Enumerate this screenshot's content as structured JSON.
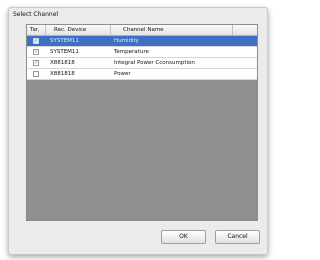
{
  "dialog": {
    "title": "Select Channel"
  },
  "table": {
    "columns": [
      "Tar.",
      "Rec. Device",
      "Channel Name"
    ],
    "rows": [
      {
        "checked": true,
        "checkbox_glyph": "✓",
        "device": "SYSTEM11",
        "name": "Humidity",
        "selected": true
      },
      {
        "checked": true,
        "checkbox_glyph": "✓",
        "device": "SYSTEM11",
        "name": "Temperature",
        "selected": false
      },
      {
        "checked": true,
        "checkbox_glyph": "✓",
        "device": "X881818",
        "name": "Integral Power Cconsumption",
        "selected": false
      },
      {
        "checked": false,
        "checkbox_glyph": "",
        "device": "X881818",
        "name": "Power",
        "selected": false
      }
    ]
  },
  "buttons": {
    "ok_label": "OK",
    "cancel_label": "Cancel"
  },
  "colors": {
    "selection": "#3d6fc4",
    "empty_area": "#8f8f8f"
  }
}
